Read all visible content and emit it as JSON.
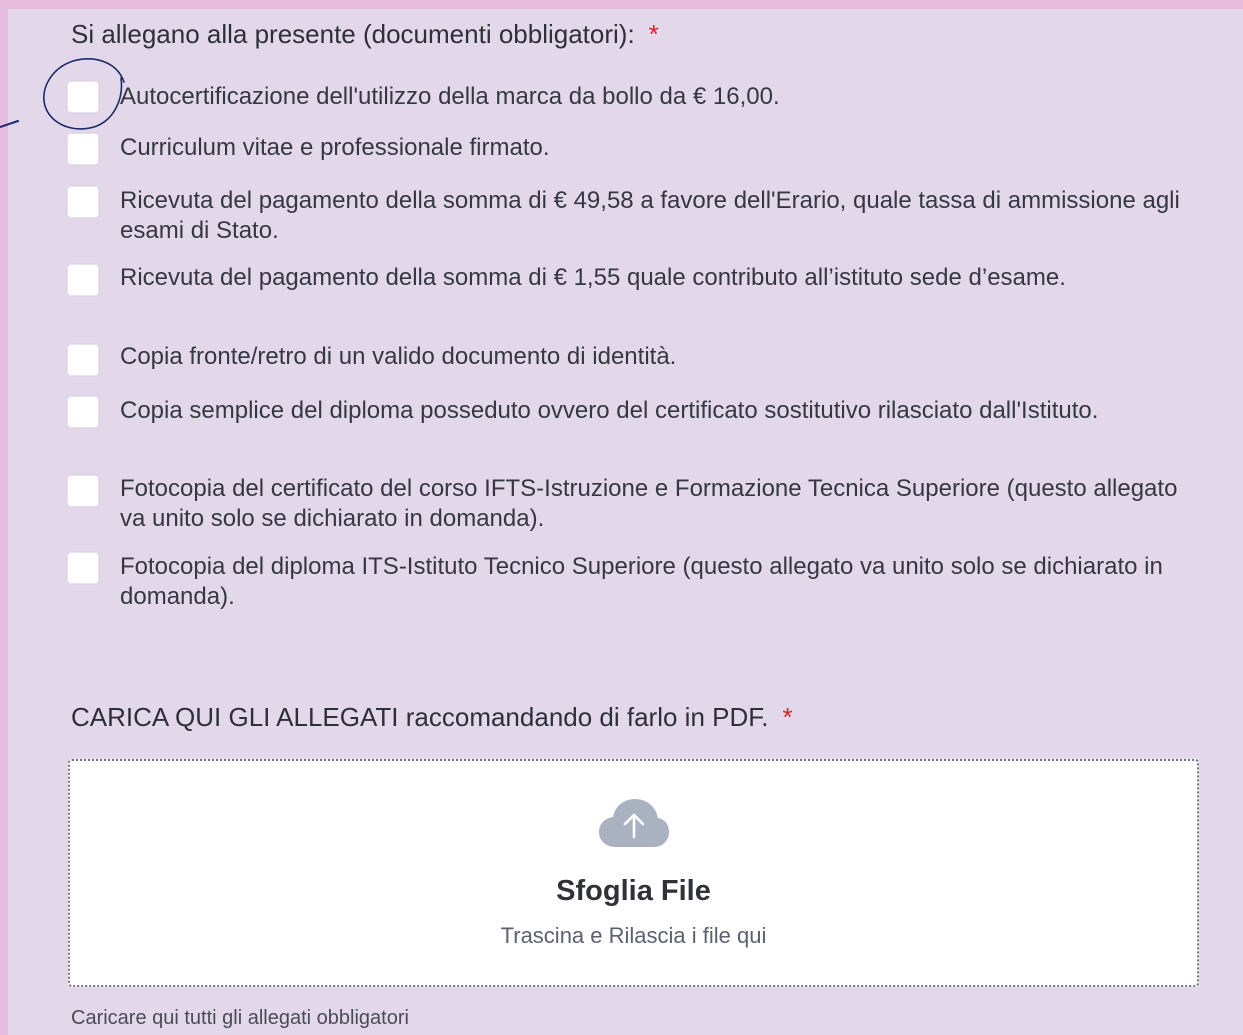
{
  "attachments": {
    "label": "Si allegano alla presente (documenti obbligatori):",
    "required_mark": "*",
    "options": [
      {
        "label": "Autocertificazione dell'utilizzo della marca da bollo da € 16,00.",
        "checked": false
      },
      {
        "label": "Curriculum vitae e professionale firmato.",
        "checked": false
      },
      {
        "label": "Ricevuta del pagamento della somma di € 49,58 a favore dell'Erario, quale tassa di ammissione agli esami di Stato.",
        "checked": false
      },
      {
        "label": "Ricevuta del pagamento della somma di € 1,55 quale contributo all’istituto sede d’esame.",
        "checked": false
      },
      {
        "label": "Copia fronte/retro di un valido documento di identità.",
        "checked": false
      },
      {
        "label": "Copia semplice del diploma posseduto ovvero del certificato sostitutivo rilasciato dall'Istituto.",
        "checked": false
      },
      {
        "label": "Fotocopia del certificato del corso IFTS-Istruzione e Formazione Tecnica Superiore (questo allegato va unito solo se dichiarato in domanda).",
        "checked": false
      },
      {
        "label": "Fotocopia del diploma ITS-Istituto Tecnico Superiore (questo allegato va unito solo se dichiarato in domanda).",
        "checked": false
      }
    ]
  },
  "upload": {
    "label": "CARICA QUI GLI ALLEGATI raccomandando di farlo in PDF.",
    "required_mark": "*",
    "icon": "cloud-upload-icon",
    "browse_label": "Sfoglia File",
    "drop_hint": "Trascina e Rilascia i file qui",
    "helper_text": "Caricare qui tutti gli allegati obbligatori"
  },
  "colors": {
    "page_background": "#e6bcdf",
    "panel_background": "#e2d8ea",
    "required_mark": "#e3202d",
    "cloud_icon": "#aab2c2",
    "annotation_ink": "#1c2a6b"
  }
}
